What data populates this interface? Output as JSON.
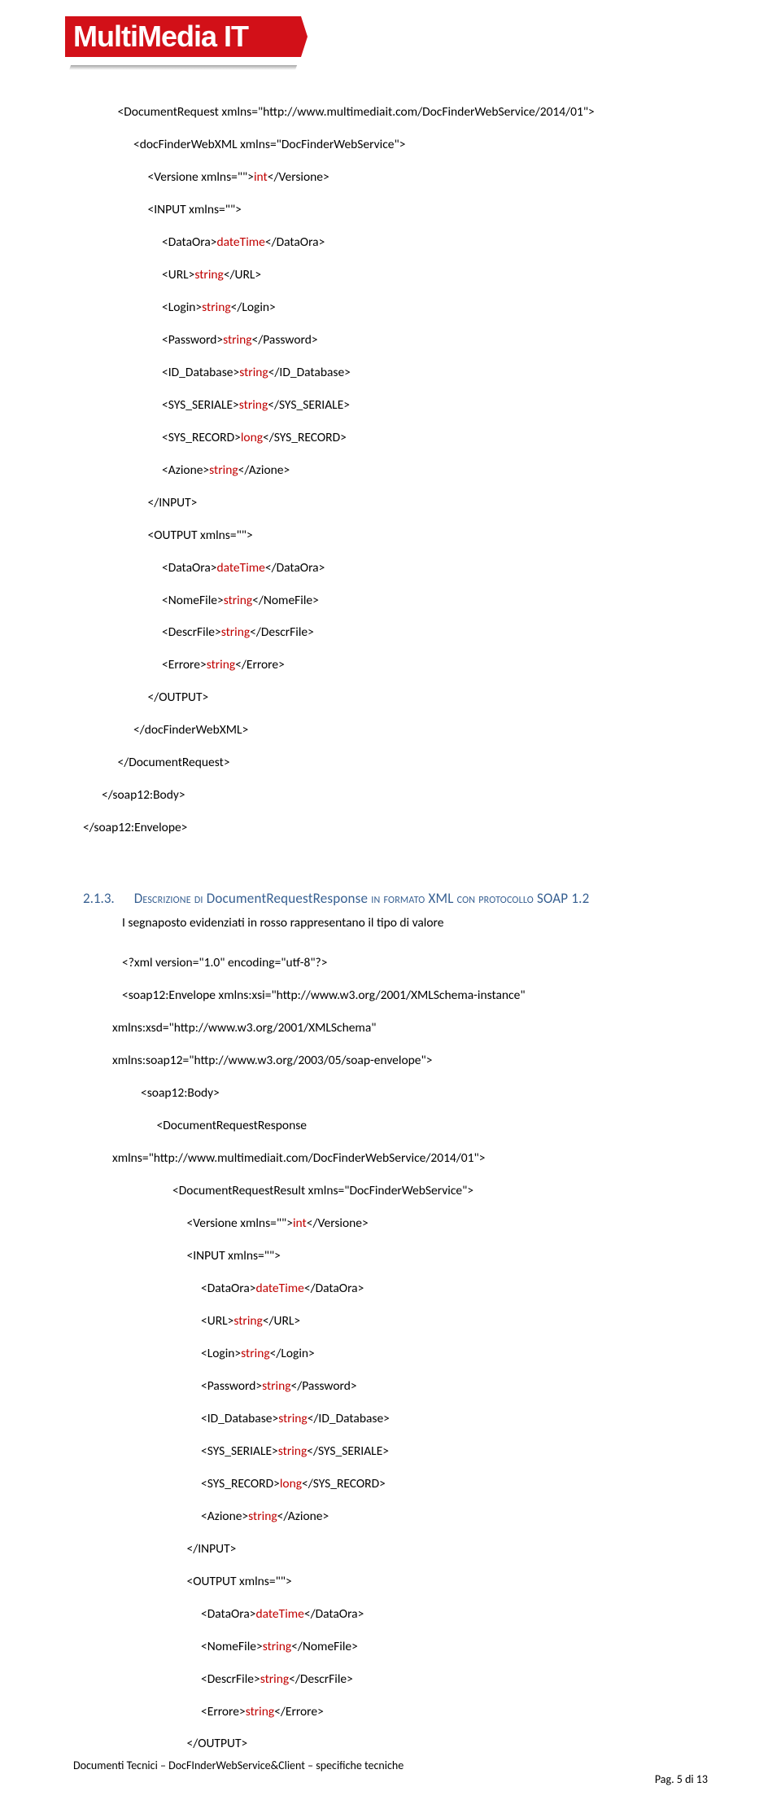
{
  "logo": {
    "text_a": "Multi",
    "text_b": "Media",
    "text_c": " IT"
  },
  "block1": {
    "l1a": "   <DocumentRequest xmlns=\"http://www.multimediait.com/DocFinderWebService/2014/01\">",
    "l2": "    <docFinderWebXML xmlns=\"DocFinderWebService\">",
    "l3a": "     <Versione xmlns=\"\">",
    "l3p": "int",
    "l3b": "</Versione>",
    "l4": "     <INPUT xmlns=\"\">",
    "l5a": "      <DataOra>",
    "l5p": "dateTime",
    "l5b": "</DataOra>",
    "l6a": "      <URL>",
    "l6p": "string",
    "l6b": "</URL>",
    "l7a": "      <Login>",
    "l7p": "string",
    "l7b": "</Login>",
    "l8a": "      <Password>",
    "l8p": "string",
    "l8b": "</Password>",
    "l9a": "      <ID_Database>",
    "l9p": "string",
    "l9b": "</ID_Database>",
    "l10a": "      <SYS_SERIALE>",
    "l10p": "string",
    "l10b": "</SYS_SERIALE>",
    "l11a": "      <SYS_RECORD>",
    "l11p": "long",
    "l11b": "</SYS_RECORD>",
    "l12a": "      <Azione>",
    "l12p": "string",
    "l12b": "</Azione>",
    "l13": "     </INPUT>",
    "l14": "     <OUTPUT xmlns=\"\">",
    "l15a": "      <DataOra>",
    "l15p": "dateTime",
    "l15b": "</DataOra>",
    "l16a": "      <NomeFile>",
    "l16p": "string",
    "l16b": "</NomeFile>",
    "l17a": "      <DescrFile>",
    "l17p": "string",
    "l17b": "</DescrFile>",
    "l18a": "      <Errore>",
    "l18p": "string",
    "l18b": "</Errore>",
    "l19": "     </OUTPUT>",
    "l20": "    </docFinderWebXML>",
    "l21": "   </DocumentRequest>",
    "l22": "  </soap12:Body>",
    "l23": "</soap12:Envelope>"
  },
  "section": {
    "num": "2.1.3.",
    "title_a": "Descrizione di ",
    "title_b": "DocumentRequestResponse",
    "title_c": " in formato ",
    "title_d": "XML",
    "title_e": " con protocollo ",
    "title_f": "SOAP 1.2"
  },
  "para1": "I segnaposto evidenziati in rosso rappresentano il tipo di valore",
  "block2": {
    "l1": "<?xml version=\"1.0\" encoding=\"utf-8\"?>",
    "l2": "<soap12:Envelope xmlns:xsi=\"http://www.w3.org/2001/XMLSchema-instance\"",
    "l3": "xmlns:xsd=\"http://www.w3.org/2001/XMLSchema\"",
    "l4": "xmlns:soap12=\"http://www.w3.org/2003/05/soap-envelope\">",
    "l5": "  <soap12:Body>",
    "l6": "   <DocumentRequestResponse",
    "l7": "xmlns=\"http://www.multimediait.com/DocFinderWebService/2014/01\">",
    "l8": "    <DocumentRequestResult xmlns=\"DocFinderWebService\">",
    "l9a": "     <Versione xmlns=\"\">",
    "l9p": "int",
    "l9b": "</Versione>",
    "l10": "     <INPUT xmlns=\"\">",
    "l11a": "      <DataOra>",
    "l11p": "dateTime",
    "l11b": "</DataOra>",
    "l12a": "      <URL>",
    "l12p": "string",
    "l12b": "</URL>",
    "l13a": "      <Login>",
    "l13p": "string",
    "l13b": "</Login>",
    "l14a": "      <Password>",
    "l14p": "string",
    "l14b": "</Password>",
    "l15a": "      <ID_Database>",
    "l15p": "string",
    "l15b": "</ID_Database>",
    "l16a": "      <SYS_SERIALE>",
    "l16p": "string",
    "l16b": "</SYS_SERIALE>",
    "l17a": "      <SYS_RECORD>",
    "l17p": "long",
    "l17b": "</SYS_RECORD>",
    "l18a": "      <Azione>",
    "l18p": "string",
    "l18b": "</Azione>",
    "l19": "     </INPUT>",
    "l20": "     <OUTPUT xmlns=\"\">",
    "l21a": "      <DataOra>",
    "l21p": "dateTime",
    "l21b": "</DataOra>",
    "l22a": "      <NomeFile>",
    "l22p": "string",
    "l22b": "</NomeFile>",
    "l23a": "      <DescrFile>",
    "l23p": "string",
    "l23b": "</DescrFile>",
    "l24a": "      <Errore>",
    "l24p": "string",
    "l24b": "</Errore>",
    "l25": "     </OUTPUT>"
  },
  "footer": {
    "left": "Documenti Tecnici – DocFInderWebService&Client – specifiche tecniche",
    "right": "Pag. 5 di 13"
  }
}
